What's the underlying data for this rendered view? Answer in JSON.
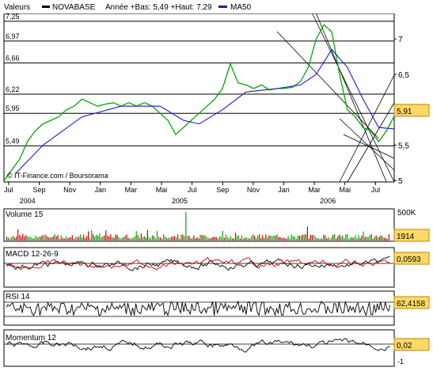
{
  "legend": {
    "instrument_label": "Valeurs",
    "instrument_name": "NOVABASE",
    "low_high": "Année +Bas: 5,49 +Haut: 7,29",
    "ma_label": "MA50",
    "instrument_color": "#000000",
    "ma_color": "#0000cc"
  },
  "watermark": "© IT-Finance.com / Boursorama",
  "colors": {
    "price": "#00aa00",
    "price_down": "#cc0000",
    "ma": "#1a1acc",
    "grid": "#000000",
    "value_box_fill": "#ffd966",
    "value_box_stroke": "#b8860b",
    "volume_up": "#00aa00",
    "volume_down": "#cc0000",
    "macd_line": "#000000",
    "macd_signal": "#cc0000"
  },
  "chart_data": [
    {
      "type": "line",
      "panel": "price",
      "title": "NOVABASE",
      "x_tick_labels": [
        "Jul",
        "Sep",
        "Nov",
        "Jan",
        "Mar",
        "Mai",
        "Jul",
        "Sep",
        "Nov",
        "Jan",
        "Mar",
        "Mai",
        "Jul"
      ],
      "year_labels": [
        "2004",
        "2005",
        "2006"
      ],
      "y_left_levels": [
        "7,25",
        "6,97",
        "6,66",
        "6,22",
        "5,95",
        "5,49"
      ],
      "y_right_ticks": [
        "7",
        "6,5",
        "6",
        "5,5",
        "5"
      ],
      "ylim": [
        4.98,
        7.36
      ],
      "last_value": "5,91",
      "series": [
        {
          "name": "NOVABASE",
          "x": [
            0,
            0.02,
            0.04,
            0.06,
            0.08,
            0.1,
            0.12,
            0.14,
            0.16,
            0.18,
            0.2,
            0.22,
            0.24,
            0.26,
            0.28,
            0.3,
            0.32,
            0.34,
            0.36,
            0.38,
            0.4,
            0.42,
            0.44,
            0.46,
            0.48,
            0.5,
            0.52,
            0.54,
            0.56,
            0.58,
            0.6,
            0.62,
            0.64,
            0.66,
            0.68,
            0.7,
            0.72,
            0.74,
            0.76,
            0.78,
            0.8,
            0.82,
            0.84,
            0.86,
            0.88,
            0.9,
            0.92,
            0.94,
            0.96,
            0.98,
            1
          ],
          "values": [
            5.0,
            5.15,
            5.3,
            5.55,
            5.7,
            5.8,
            5.85,
            5.9,
            6.0,
            6.05,
            6.15,
            6.1,
            6.05,
            6.08,
            6.1,
            6.05,
            6.1,
            6.05,
            6.1,
            6.05,
            5.95,
            5.85,
            5.65,
            5.75,
            5.85,
            5.95,
            6.05,
            6.15,
            6.3,
            6.65,
            6.38,
            6.35,
            6.3,
            6.35,
            6.28,
            6.3,
            6.3,
            6.32,
            6.4,
            6.6,
            7.0,
            7.2,
            7.1,
            6.5,
            6.0,
            5.9,
            5.75,
            5.7,
            5.55,
            5.7,
            5.91
          ]
        },
        {
          "name": "MA50",
          "x": [
            0.03,
            0.1,
            0.2,
            0.3,
            0.4,
            0.46,
            0.5,
            0.56,
            0.62,
            0.7,
            0.76,
            0.8,
            0.84,
            0.88,
            0.92,
            0.96,
            1
          ],
          "values": [
            5.1,
            5.5,
            5.9,
            6.05,
            6.05,
            5.85,
            5.8,
            6.0,
            6.25,
            6.3,
            6.35,
            6.5,
            6.85,
            6.6,
            6.15,
            5.75,
            5.73
          ]
        }
      ]
    },
    {
      "type": "bar",
      "panel": "volume",
      "title": "Volume 15",
      "axis_max": "500K",
      "last_value": "1914"
    },
    {
      "type": "line",
      "panel": "macd",
      "title": "MACD 12-26-9",
      "last_value": "0,0593"
    },
    {
      "type": "line",
      "panel": "rsi",
      "title": "RSI 14",
      "last_value": "62,4158"
    },
    {
      "type": "line",
      "panel": "momentum",
      "title": "Momentum 12",
      "y_tick": "-1",
      "last_value": "0,02"
    }
  ]
}
